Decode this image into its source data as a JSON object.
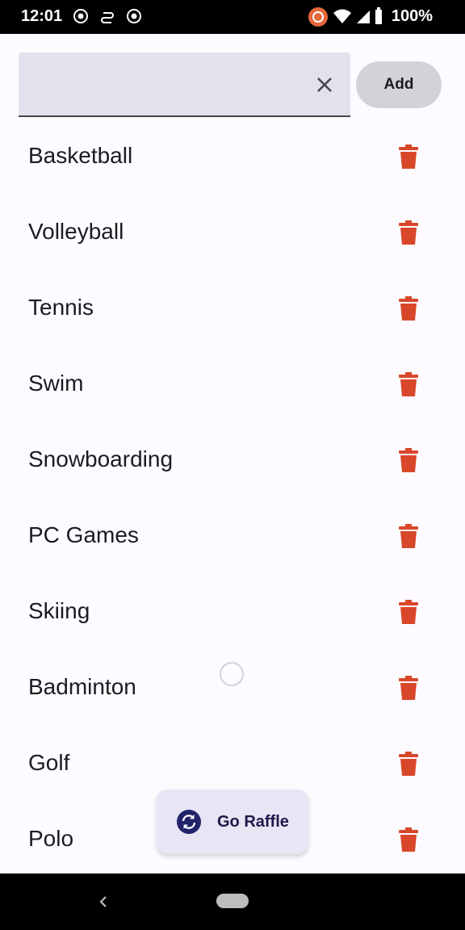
{
  "status_bar": {
    "time": "12:01",
    "battery": "100%"
  },
  "search": {
    "value": "",
    "clear_icon": "close-icon"
  },
  "add_button": {
    "label": "Add"
  },
  "items": [
    {
      "label": "Basketball"
    },
    {
      "label": "Volleyball"
    },
    {
      "label": "Tennis"
    },
    {
      "label": "Swim"
    },
    {
      "label": "Snowboarding"
    },
    {
      "label": "PC Games"
    },
    {
      "label": "Skiing"
    },
    {
      "label": "Badminton"
    },
    {
      "label": "Golf"
    },
    {
      "label": "Polo"
    }
  ],
  "fab": {
    "label": "Go Raffle",
    "icon": "sync-icon"
  },
  "colors": {
    "delete": "#d9472a",
    "fab_background": "#e8e5f4",
    "fab_icon": "#23236b",
    "field_background": "#e5e1ec"
  }
}
